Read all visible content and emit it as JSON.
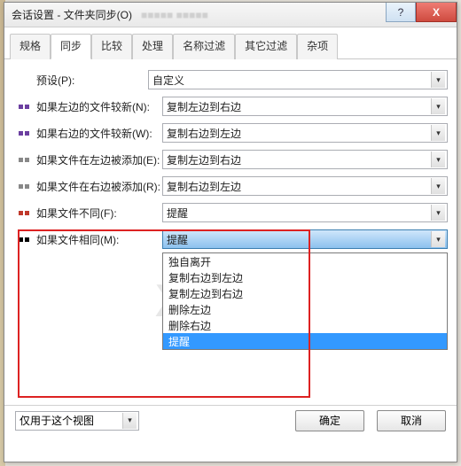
{
  "window": {
    "title": "会话设置 - 文件夹同步(O)",
    "blurred_hint": "■■■■■  ■■■■■"
  },
  "winbuttons": {
    "help": "?",
    "close": "X"
  },
  "tabs": [
    "规格",
    "同步",
    "比较",
    "处理",
    "名称过滤",
    "其它过滤",
    "杂项"
  ],
  "active_tab_index": 1,
  "preset": {
    "label": "预设(P):",
    "value": "自定义"
  },
  "rows": [
    {
      "marker": "purple",
      "label": "如果左边的文件较新(N):",
      "value": "复制左边到右边"
    },
    {
      "marker": "purple",
      "label": "如果右边的文件较新(W):",
      "value": "复制右边到左边"
    },
    {
      "marker": "gray",
      "label": "如果文件在左边被添加(E):",
      "value": "复制左边到右边"
    },
    {
      "marker": "gray",
      "label": "如果文件在右边被添加(R):",
      "value": "复制右边到左边"
    },
    {
      "marker": "red",
      "label": "如果文件不同(F):",
      "value": "提醒"
    },
    {
      "marker": "black",
      "label": "如果文件相同(M):",
      "value": "提醒",
      "open": true
    }
  ],
  "dropdown_items": [
    "独自离开",
    "复制右边到左边",
    "复制左边到右边",
    "删除左边",
    "删除右边",
    "提醒"
  ],
  "dropdown_selected_index": 5,
  "footer": {
    "scope": "仅用于这个视图",
    "ok": "确定",
    "cancel": "取消"
  },
  "watermark": "X  I 网"
}
